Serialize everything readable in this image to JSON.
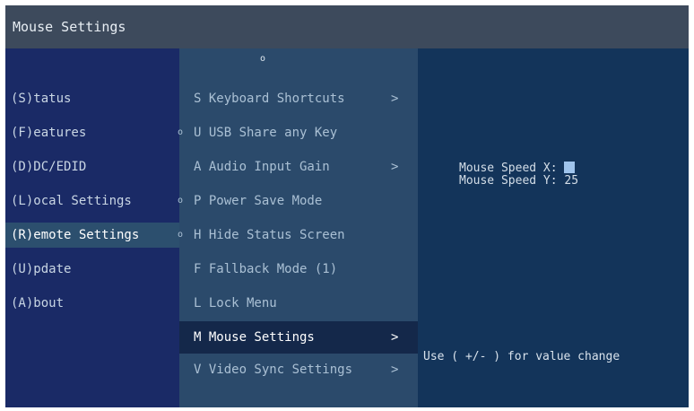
{
  "title": "Mouse Settings",
  "menu": [
    {
      "label": "(S)tatus"
    },
    {
      "label": "(F)eatures"
    },
    {
      "label": "(D)DC/EDID"
    },
    {
      "label": "(L)ocal  Settings"
    },
    {
      "label": "(R)emote Settings",
      "active": true
    },
    {
      "label": "(U)pdate"
    },
    {
      "label": "(A)bout"
    }
  ],
  "submenu": [
    {
      "label": "S Keyboard Shortcuts",
      "arrow": ">"
    },
    {
      "label": "U USB Share any Key",
      "marker": "o"
    },
    {
      "label": "A Audio Input Gain",
      "arrow": ">"
    },
    {
      "label": "P Power Save Mode",
      "marker": "o"
    },
    {
      "label": "H Hide Status Screen",
      "marker": "o"
    },
    {
      "label": "F Fallback Mode (1)"
    },
    {
      "label": "L Lock Menu"
    },
    {
      "label": "M Mouse Settings",
      "arrow": ">",
      "selected": true
    },
    {
      "label": "V Video Sync Settings",
      "arrow": ">"
    }
  ],
  "submenu_top_marker": "o",
  "settings": {
    "speed_x_label": "Mouse Speed X:",
    "speed_x_value": "",
    "speed_y_label": "Mouse Speed Y:",
    "speed_y_value": "25"
  },
  "hint": "Use ( +/- ) for value change"
}
